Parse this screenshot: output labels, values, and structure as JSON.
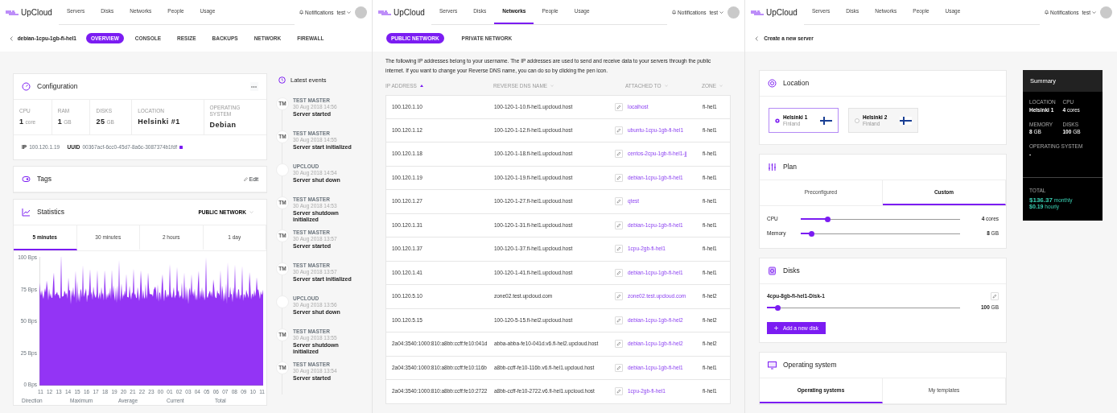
{
  "server_view": {
    "header": {
      "logo": "UpCloud",
      "nav": [
        {
          "label": "Servers",
          "selected": false
        },
        {
          "label": "Disks",
          "selected": false
        },
        {
          "label": "Networks",
          "selected": false
        },
        {
          "label": "People",
          "selected": false
        },
        {
          "label": "Usage",
          "selected": false
        }
      ],
      "notifications": "Notifications",
      "user": "test"
    },
    "title": "debian-1cpu-1gb-fi-hel1",
    "tabs": [
      {
        "label": "OVERVIEW",
        "selected": true
      },
      {
        "label": "CONSOLE",
        "selected": false
      },
      {
        "label": "RESIZE",
        "selected": false
      },
      {
        "label": "BACKUPS",
        "selected": false
      },
      {
        "label": "NETWORK",
        "selected": false
      },
      {
        "label": "FIREWALL",
        "selected": false
      }
    ],
    "configuration": {
      "title": "Configuration",
      "specs": [
        {
          "label": "CPU",
          "value": "1",
          "unit": "core"
        },
        {
          "label": "RAM",
          "value": "1",
          "unit": "GB"
        },
        {
          "label": "DISKS",
          "value": "25",
          "unit": "GB"
        },
        {
          "label": "LOCATION",
          "value": "Helsinki #1"
        },
        {
          "label": "OPERATING SYSTEM",
          "value": "Debian"
        }
      ],
      "ip_label": "IP",
      "ip": "100.120.1.19",
      "uuid_label": "UUID",
      "uuid": "00367acf-6cc0-45d7-8a6c-3087374b1fdf"
    },
    "tags": {
      "title": "Tags",
      "edit": "Edit"
    },
    "statistics": {
      "title": "Statistics",
      "network": "PUBLIC NETWORK",
      "ranges": [
        {
          "label": "5 minutes",
          "selected": true
        },
        {
          "label": "30 minutes",
          "selected": false
        },
        {
          "label": "2 hours",
          "selected": false
        },
        {
          "label": "1 day",
          "selected": false
        }
      ],
      "yticks": [
        "100 Bps",
        "75 Bps",
        "50 Bps",
        "25 Bps",
        "0 Bps"
      ],
      "xticks": [
        "11",
        "12",
        "13",
        "14",
        "15",
        "16",
        "17",
        "18",
        "19",
        "20",
        "21",
        "22",
        "23",
        "00",
        "01",
        "02",
        "03",
        "04",
        "05",
        "06",
        "07",
        "08",
        "09",
        "10",
        "11"
      ],
      "columns": [
        "Direction",
        "Maximum",
        "Average",
        "Current",
        "Total"
      ]
    },
    "events": {
      "title": "Latest events",
      "items": [
        {
          "initials": "TM",
          "author": "TEST MASTER",
          "time": "30 Aug 2018 14:56",
          "text": "Server started"
        },
        {
          "initials": "TM",
          "author": "TEST MASTER",
          "time": "30 Aug 2018 14:55",
          "text": "Server start initialized"
        },
        {
          "author": "UPCLOUD",
          "time": "30 Aug 2018 14:54",
          "text": "Server shut down"
        },
        {
          "initials": "TM",
          "author": "TEST MASTER",
          "time": "30 Aug 2018 14:53",
          "text": "Server shutdown initialized"
        },
        {
          "initials": "TM",
          "author": "TEST MASTER",
          "time": "30 Aug 2018 13:57",
          "text": "Server started"
        },
        {
          "initials": "TM",
          "author": "TEST MASTER",
          "time": "30 Aug 2018 13:57",
          "text": "Server start initialized"
        },
        {
          "author": "UPCLOUD",
          "time": "30 Aug 2018 13:56",
          "text": "Server shut down"
        },
        {
          "initials": "TM",
          "author": "TEST MASTER",
          "time": "30 Aug 2018 13:55",
          "text": "Server shutdown initialized"
        },
        {
          "initials": "TM",
          "author": "TEST MASTER",
          "time": "30 Aug 2018 13:54",
          "text": "Server started"
        }
      ]
    }
  },
  "networks_view": {
    "header": {
      "logo": "UpCloud",
      "nav": [
        {
          "label": "Servers",
          "selected": false
        },
        {
          "label": "Disks",
          "selected": false
        },
        {
          "label": "Networks",
          "selected": true
        },
        {
          "label": "People",
          "selected": false
        },
        {
          "label": "Usage",
          "selected": false
        }
      ],
      "notifications": "Notifications",
      "user": "test"
    },
    "tabs": [
      {
        "label": "PUBLIC NETWORK",
        "selected": true
      },
      {
        "label": "PRIVATE NETWORK",
        "selected": false
      }
    ],
    "intro": "The following IP addresses belong to your username. The IP addresses are used to send and receive data to your servers through the public internet. If you want to change your Reverse DNS name, you can do so by clicking the pen icon.",
    "columns": [
      {
        "label": "IP ADDRESS",
        "sorted": true
      },
      {
        "label": "REVERSE DNS NAME",
        "sorted": false
      },
      {
        "label": "ATTACHED TO",
        "sorted": false
      },
      {
        "label": "ZONE",
        "sorted": false
      }
    ],
    "rows": [
      {
        "ip": "100.120.1.10",
        "dns": "100-120-1-10.fi-hel1.upcloud.host",
        "attached": "localhost",
        "zone": "fi-hel1"
      },
      {
        "ip": "100.120.1.12",
        "dns": "100-120-1-12.fi-hel1.upcloud.host",
        "attached": "ubuntu-1cpu-1gb-fi-hel1",
        "zone": "fi-hel1"
      },
      {
        "ip": "100.120.1.18",
        "dns": "100-120-1-18.fi-hel1.upcloud.host",
        "attached": "centos-2cpu-1gb-fi-hel1-jj",
        "zone": "fi-hel1"
      },
      {
        "ip": "100.120.1.19",
        "dns": "100-120-1-19.fi-hel1.upcloud.host",
        "attached": "debian-1cpu-1gb-fi-hel1",
        "zone": "fi-hel1"
      },
      {
        "ip": "100.120.1.27",
        "dns": "100-120-1-27.fi-hel1.upcloud.host",
        "attached": "qtest",
        "zone": "fi-hel1"
      },
      {
        "ip": "100.120.1.31",
        "dns": "100-120-1-31.fi-hel1.upcloud.host",
        "attached": "debian-1cpu-1gb-fi-hel1",
        "zone": "fi-hel1"
      },
      {
        "ip": "100.120.1.37",
        "dns": "100-120-1-37.fi-hel1.upcloud.host",
        "attached": "1cpu-2gb-fi-hel1",
        "zone": "fi-hel1"
      },
      {
        "ip": "100.120.1.41",
        "dns": "100-120-1-41.fi-hel1.upcloud.host",
        "attached": "debian-1cpu-1gb-fi-hel1",
        "zone": "fi-hel1"
      },
      {
        "ip": "100.120.5.10",
        "dns": "zone02.test.upcloud.com",
        "attached": "zone02.test.upcloud.com",
        "zone": "fi-hel2"
      },
      {
        "ip": "100.120.5.15",
        "dns": "100-120-5-15.fi-hel2.upcloud.host",
        "attached": "debian-1cpu-1gb-fi-hel2",
        "zone": "fi-hel2"
      },
      {
        "ip": "2a04:3540:1000:810:a8bb:ccff:fe10:041d",
        "dns": "abba-abba-fe10-041d.v6.fi-hel2.upcloud.host",
        "attached": "debian-1cpu-1gb-fi-hel2",
        "zone": "fi-hel2"
      },
      {
        "ip": "2a04:3540:1000:810:a8bb:ccff:fe10:116b",
        "dns": "a8bb-ccff-fe10-116b.v6.fi-hel1.upcloud.host",
        "attached": "debian-1cpu-1gb-fi-hel1",
        "zone": "fi-hel1"
      },
      {
        "ip": "2a04:3540:1000:810:a8bb:ccff:fe10:2722",
        "dns": "a8bb-ccff-fe10-2722.v6.fi-hel1.upcloud.host",
        "attached": "1cpu-2gb-fi-hel1",
        "zone": "fi-hel1"
      }
    ]
  },
  "create_view": {
    "header": {
      "logo": "UpCloud",
      "nav": [
        {
          "label": "Servers",
          "selected": false
        },
        {
          "label": "Disks",
          "selected": false
        },
        {
          "label": "Networks",
          "selected": false
        },
        {
          "label": "People",
          "selected": false
        },
        {
          "label": "Usage",
          "selected": false
        }
      ],
      "notifications": "Notifications",
      "user": "test"
    },
    "title": "Create a new server",
    "location": {
      "title": "Location",
      "options": [
        {
          "name": "Helsinki 1",
          "country": "Finland",
          "selected": true
        },
        {
          "name": "Helsinki 2",
          "country": "Finland",
          "selected": false
        }
      ]
    },
    "plan": {
      "title": "Plan",
      "tabs": [
        {
          "label": "Preconfigured",
          "selected": false
        },
        {
          "label": "Custom",
          "selected": true
        }
      ],
      "sliders": [
        {
          "label": "CPU",
          "level": 0.17,
          "value": "4",
          "unit": "cores"
        },
        {
          "label": "Memory",
          "level": 0.07,
          "value": "8",
          "unit": "GB"
        }
      ]
    },
    "disks": {
      "title": "Disks",
      "items": [
        {
          "name": "4cpu-8gb-fi-hel1-Disk-1",
          "level": 0.055,
          "value": "100",
          "unit": "GB"
        }
      ],
      "add": "Add a new disk"
    },
    "os": {
      "title": "Operating system",
      "tabs": [
        {
          "label": "Operating systems",
          "selected": true
        },
        {
          "label": "My templates",
          "selected": false
        }
      ]
    },
    "summary": {
      "title": "Summary",
      "fields": [
        {
          "label": "LOCATION",
          "value": "Helsinki 1"
        },
        {
          "label": "CPU",
          "value": "4",
          "unit": "cores"
        },
        {
          "label": "MEMORY",
          "value": "8",
          "unit": "GB"
        },
        {
          "label": "DISKS",
          "value": "100",
          "unit": "GB"
        },
        {
          "label": "OPERATING SYSTEM",
          "value": "-"
        }
      ],
      "total_label": "TOTAL",
      "prices": [
        {
          "amount": "$136.37",
          "period": "monthly"
        },
        {
          "amount": "$0.19",
          "period": "hourly"
        }
      ]
    }
  }
}
